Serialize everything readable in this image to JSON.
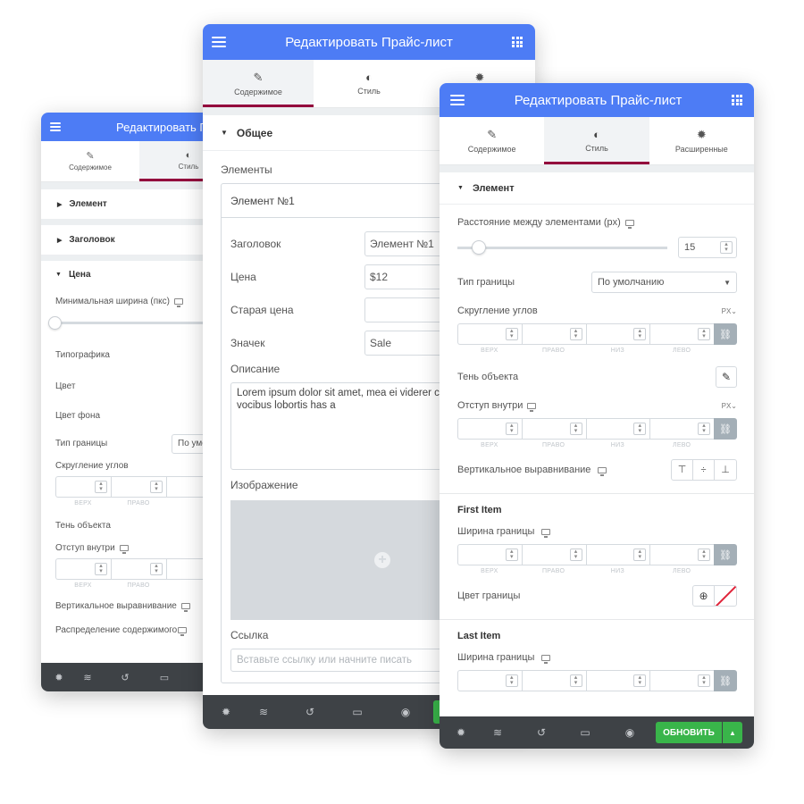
{
  "panel_left": {
    "title": "Редактировать Пр",
    "tabs": [
      {
        "label": "Содержимое"
      },
      {
        "label": "Стиль"
      }
    ],
    "sections": {
      "element": "Элемент",
      "heading": "Заголовок",
      "price": "Цена"
    },
    "min_width_label": "Минимальная ширина (пкс)",
    "typography": "Типографика",
    "color": "Цвет",
    "bg_color": "Цвет фона",
    "border_type": "Тип границы",
    "border_type_value": "По умо",
    "border_radius": "Скругление углов",
    "dims": [
      "ВЕРХ",
      "ПРАВО",
      "НИЗ"
    ],
    "shadow": "Тень объекта",
    "padding": "Отступ внутри",
    "valign": "Вертикальное выравнивание",
    "distribution": "Распределение содержимого"
  },
  "panel_mid": {
    "title": "Редактировать Прайс-лист",
    "tabs": [
      {
        "label": "Содержимое"
      },
      {
        "label": "Стиль"
      }
    ],
    "section": "Общее",
    "elements_label": "Элементы",
    "item_title": "Элемент №1",
    "fields": [
      {
        "label": "Заголовок",
        "value": "Элемент №1"
      },
      {
        "label": "Цена",
        "value": "$12"
      },
      {
        "label": "Старая цена",
        "value": ""
      },
      {
        "label": "Значек",
        "value": "Sale"
      }
    ],
    "description_label": "Описание",
    "description_text": "Lorem ipsum dolor sit amet, mea ei viderer consequuntur, sonet vocibus lobortis has a",
    "image_label": "Изображение",
    "link_label": "Ссылка",
    "link_placeholder": "Вставьте ссылку или начните писать"
  },
  "panel_right": {
    "title": "Редактировать Прайс-лист",
    "tabs": [
      {
        "label": "Содержимое"
      },
      {
        "label": "Стиль"
      },
      {
        "label": "Расширенные"
      }
    ],
    "section": "Элемент",
    "spacing_label": "Расстояние между элементами (px)",
    "spacing_value": "15",
    "spacing_fraction": 0.1,
    "border_type": "Тип границы",
    "border_type_value": "По умолчанию",
    "border_radius": "Скругление углов",
    "unit_px": "PX",
    "dims": [
      "ВЕРХ",
      "ПРАВО",
      "НИЗ",
      "ЛЕВО"
    ],
    "shadow": "Тень объекта",
    "padding": "Отступ внутри",
    "valign": "Вертикальное выравнивание",
    "first_item": "First Item",
    "border_width": "Ширина границы",
    "border_color": "Цвет границы",
    "last_item": "Last Item",
    "update_button": "ОБНОВИТЬ"
  },
  "colors": {
    "header": "#4d7cf5",
    "accent": "#93003c",
    "footer": "#3e4246",
    "update": "#39b54a"
  }
}
